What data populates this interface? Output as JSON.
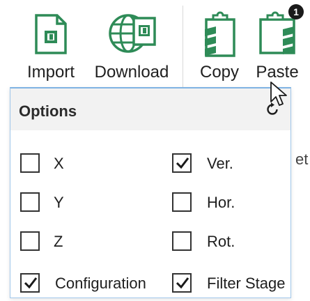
{
  "ribbon": {
    "import_label": "Import",
    "download_label": "Download",
    "copy_label": "Copy",
    "paste_label": "Paste",
    "paste_badge": "1",
    "accent_color": "#2e8b57"
  },
  "options_panel": {
    "title": "Options",
    "items": [
      {
        "label": "X",
        "checked": false
      },
      {
        "label": "Ver.",
        "checked": true
      },
      {
        "label": "Y",
        "checked": false
      },
      {
        "label": "Hor.",
        "checked": false
      },
      {
        "label": "Z",
        "checked": false
      },
      {
        "label": "Rot.",
        "checked": false
      },
      {
        "label": "Configuration",
        "checked": true
      },
      {
        "label": "Filter Stage",
        "checked": true
      }
    ]
  },
  "background": {
    "partial_text": "et"
  }
}
